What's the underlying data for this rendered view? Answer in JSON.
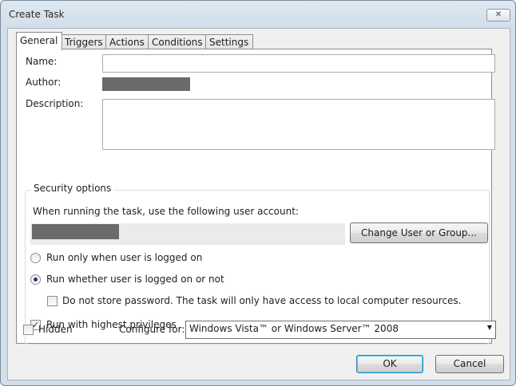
{
  "window": {
    "title": "Create Task",
    "close_glyph": "✕"
  },
  "tabs": [
    {
      "label": "General"
    },
    {
      "label": "Triggers"
    },
    {
      "label": "Actions"
    },
    {
      "label": "Conditions"
    },
    {
      "label": "Settings"
    }
  ],
  "general": {
    "name_label": "Name:",
    "name_value": "",
    "author_label": "Author:",
    "description_label": "Description:",
    "description_value": ""
  },
  "security": {
    "title": "Security options",
    "account_prompt": "When running the task, use the following user account:",
    "change_user_button": "Change User or Group...",
    "radio_logged_on": {
      "label": "Run only when user is logged on",
      "selected": false
    },
    "radio_whether": {
      "label": "Run whether user is logged on or not",
      "selected": true
    },
    "no_store_password": {
      "label": "Do not store password.  The task will only have access to local computer resources.",
      "checked": false
    },
    "highest_privileges": {
      "label": "Run with highest privileges",
      "checked": true
    }
  },
  "footer": {
    "hidden": {
      "label": "Hidden",
      "checked": false
    },
    "configure_label": "Configure for:",
    "configure_value": "Windows Vista™ or Windows Server™ 2008",
    "ok_button": "OK",
    "cancel_button": "Cancel"
  },
  "icons": {
    "check": "✓",
    "dropdown": "▼"
  }
}
